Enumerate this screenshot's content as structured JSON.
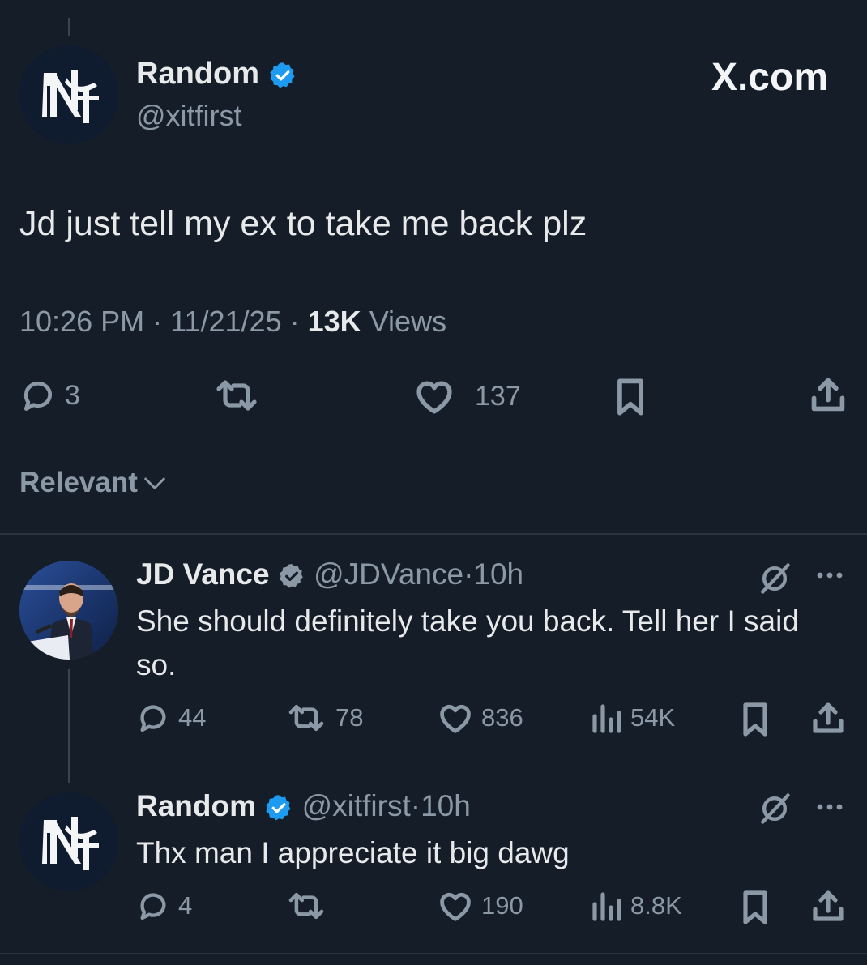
{
  "main_post": {
    "display_name": "Random",
    "handle": "@xitfirst",
    "site_label": "X.com",
    "text": "Jd just tell my ex to take me back plz",
    "time": "10:26 PM",
    "date": "11/21/25",
    "views_count": "13K",
    "views_label": "Views",
    "replies": "3",
    "likes": "137"
  },
  "sort": {
    "label": "Relevant"
  },
  "replies": [
    {
      "display_name": "JD Vance",
      "handle": "@JDVance",
      "age": "10h",
      "text": "She should definitely take you back. Tell her I said so.",
      "replies": "44",
      "reposts": "78",
      "likes": "836",
      "views": "54K"
    },
    {
      "display_name": "Random",
      "handle": "@xitfirst",
      "age": "10h",
      "text": "Thx man I appreciate it big dawg",
      "replies": "4",
      "likes": "190",
      "views": "8.8K"
    }
  ],
  "colors": {
    "background": "#151d28",
    "text": "#e7e9ea",
    "muted": "#8b98a5",
    "verified": "#1d9bf0"
  }
}
